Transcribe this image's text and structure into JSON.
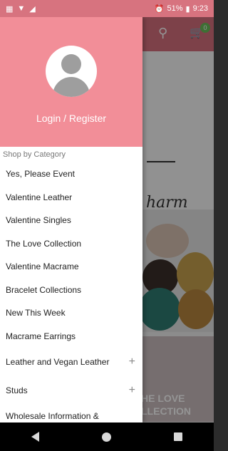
{
  "status_bar": {
    "battery": "51%",
    "time": "9:23",
    "alarm_icon": "alarm-icon",
    "wifi_icon": "wifi-icon",
    "signal_icon": "signal-icon",
    "battery_icon": "battery-icon"
  },
  "background": {
    "cart_count": "0",
    "script_text": "harm",
    "collection_text_line1": "HE LOVE",
    "collection_text_line2": "LLECTION",
    "colors": {
      "header": "#d8707e",
      "cart_badge": "#6bbf5b"
    }
  },
  "drawer": {
    "header_color": "#f28e98",
    "login_label": "Login / Register",
    "section_label": "Shop by Category",
    "items": [
      {
        "label": "Yes, Please Event"
      },
      {
        "label": "Valentine Leather"
      },
      {
        "label": "Valentine Singles"
      },
      {
        "label": "The Love Collection"
      },
      {
        "label": "Valentine Macrame"
      },
      {
        "label": "Bracelet Collections"
      },
      {
        "label": "New This Week"
      },
      {
        "label": "Macrame Earrings"
      },
      {
        "label": "Leather and Vegan Leather",
        "expand": "+"
      },
      {
        "label": "Studs",
        "expand": "+"
      },
      {
        "label": "Wholesale Information &"
      }
    ]
  }
}
